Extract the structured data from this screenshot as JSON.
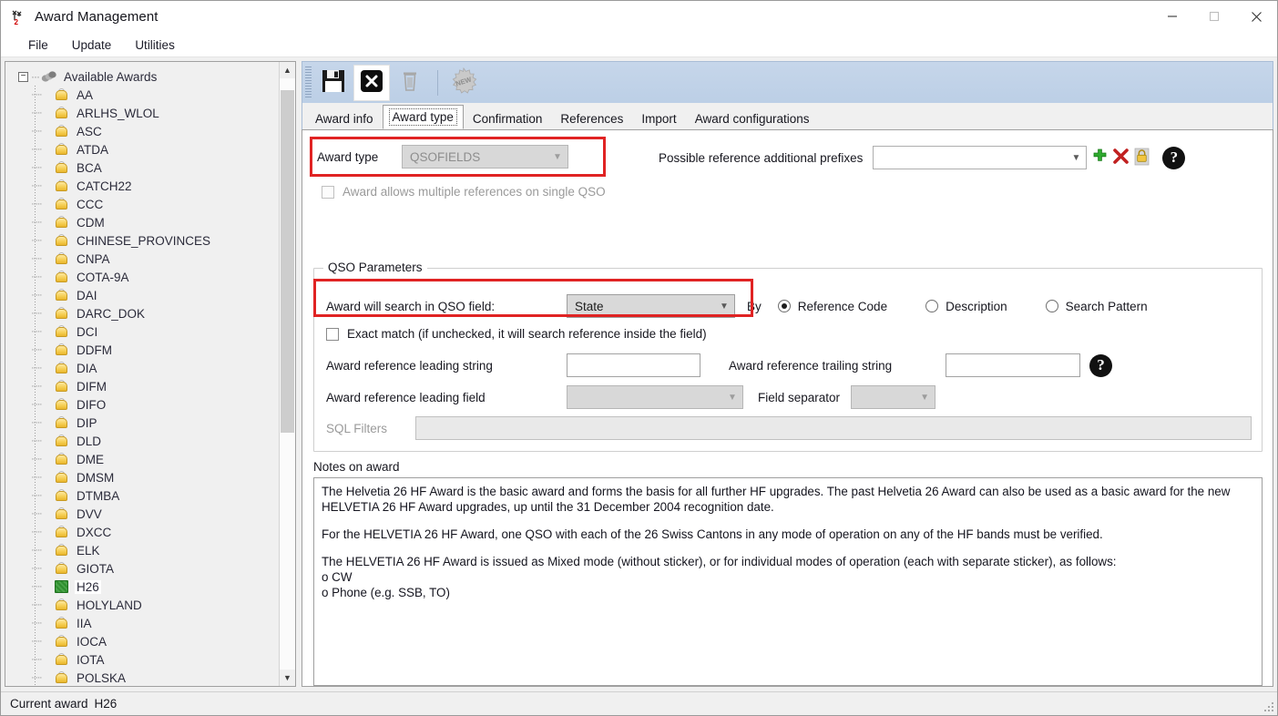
{
  "window": {
    "title": "Award Management",
    "app_icon": "antenna-icon",
    "controls": {
      "minimize": "minimize-icon",
      "maximize": "maximize-icon",
      "close": "close-icon"
    }
  },
  "menubar": {
    "items": [
      "File",
      "Update",
      "Utilities"
    ]
  },
  "sidebar": {
    "root_label": "Available Awards",
    "root_icon": "awards-stack-icon",
    "items": [
      {
        "label": "AA",
        "icon": "award-bell-icon",
        "selected": false
      },
      {
        "label": "ARLHS_WLOL",
        "icon": "award-bell-icon",
        "selected": false
      },
      {
        "label": "ASC",
        "icon": "award-bell-icon",
        "selected": false
      },
      {
        "label": "ATDA",
        "icon": "award-bell-icon",
        "selected": false
      },
      {
        "label": "BCA",
        "icon": "award-bell-icon",
        "selected": false
      },
      {
        "label": "CATCH22",
        "icon": "award-bell-icon",
        "selected": false
      },
      {
        "label": "CCC",
        "icon": "award-bell-icon",
        "selected": false
      },
      {
        "label": "CDM",
        "icon": "award-bell-icon",
        "selected": false
      },
      {
        "label": "CHINESE_PROVINCES",
        "icon": "award-bell-icon",
        "selected": false
      },
      {
        "label": "CNPA",
        "icon": "award-bell-icon",
        "selected": false
      },
      {
        "label": "COTA-9A",
        "icon": "award-bell-icon",
        "selected": false
      },
      {
        "label": "DAI",
        "icon": "award-bell-icon",
        "selected": false
      },
      {
        "label": "DARC_DOK",
        "icon": "award-bell-icon",
        "selected": false
      },
      {
        "label": "DCI",
        "icon": "award-bell-icon",
        "selected": false
      },
      {
        "label": "DDFM",
        "icon": "award-bell-icon",
        "selected": false
      },
      {
        "label": "DIA",
        "icon": "award-bell-icon",
        "selected": false
      },
      {
        "label": "DIFM",
        "icon": "award-bell-icon",
        "selected": false
      },
      {
        "label": "DIFO",
        "icon": "award-bell-icon",
        "selected": false
      },
      {
        "label": "DIP",
        "icon": "award-bell-icon",
        "selected": false
      },
      {
        "label": "DLD",
        "icon": "award-bell-icon",
        "selected": false
      },
      {
        "label": "DME",
        "icon": "award-bell-icon",
        "selected": false
      },
      {
        "label": "DMSM",
        "icon": "award-bell-icon",
        "selected": false
      },
      {
        "label": "DTMBA",
        "icon": "award-bell-icon",
        "selected": false
      },
      {
        "label": "DVV",
        "icon": "award-bell-icon",
        "selected": false
      },
      {
        "label": "DXCC",
        "icon": "award-bell-icon",
        "selected": false
      },
      {
        "label": "ELK",
        "icon": "award-bell-icon",
        "selected": false
      },
      {
        "label": "GIOTA",
        "icon": "award-bell-icon",
        "selected": false
      },
      {
        "label": "H26",
        "icon": "award-selected-icon",
        "selected": true
      },
      {
        "label": "HOLYLAND",
        "icon": "award-bell-icon",
        "selected": false
      },
      {
        "label": "IIA",
        "icon": "award-bell-icon",
        "selected": false
      },
      {
        "label": "IOCA",
        "icon": "award-bell-icon",
        "selected": false
      },
      {
        "label": "IOTA",
        "icon": "award-bell-icon",
        "selected": false
      },
      {
        "label": "POLSKA",
        "icon": "award-bell-icon",
        "selected": false
      }
    ]
  },
  "toolbar": {
    "buttons": [
      {
        "name": "save-button",
        "icon": "floppy-disk-icon",
        "enabled": true,
        "hot": false
      },
      {
        "name": "cancel-button",
        "icon": "black-x-icon",
        "enabled": true,
        "hot": true
      },
      {
        "name": "delete-button",
        "icon": "trash-icon",
        "enabled": false,
        "hot": false
      },
      {
        "name": "new-button",
        "icon": "new-starburst-icon",
        "enabled": false,
        "hot": false
      }
    ]
  },
  "tabs": [
    {
      "label": "Award info",
      "active": false
    },
    {
      "label": "Award type",
      "active": true
    },
    {
      "label": "Confirmation",
      "active": false
    },
    {
      "label": "References",
      "active": false
    },
    {
      "label": "Import",
      "active": false
    },
    {
      "label": "Award configurations",
      "active": false
    }
  ],
  "award_type_panel": {
    "award_type_label": "Award type",
    "award_type_value": "QSOFIELDS",
    "award_type_enabled": false,
    "prefixes_label": "Possible reference additional prefixes",
    "prefixes_value": "",
    "prefixes_add_icon": "green-plus-icon",
    "prefixes_delete_icon": "red-x-icon",
    "prefixes_lock_icon": "yellow-lock-icon",
    "help_icon": "question-mark-icon",
    "multiple_refs_label": "Award allows multiple references on single QSO",
    "multiple_refs_checked": false,
    "multiple_refs_enabled": false
  },
  "qso_parameters": {
    "group_title": "QSO Parameters",
    "search_field_label": "Award will search in QSO field:",
    "search_field_value": "State",
    "by_label": "By",
    "by_options": [
      {
        "label": "Reference Code",
        "selected": true
      },
      {
        "label": "Description",
        "selected": false
      },
      {
        "label": "Search Pattern",
        "selected": false
      }
    ],
    "exact_match_label": "Exact match (if unchecked, it will search reference inside the field)",
    "exact_match_checked": false,
    "leading_string_label": "Award reference leading string",
    "leading_string_value": "",
    "trailing_string_label": "Award reference trailing string",
    "trailing_string_value": "",
    "leading_field_label": "Award reference leading field",
    "leading_field_value": "",
    "field_separator_label": "Field separator",
    "field_separator_value": "",
    "sql_filters_label": "SQL Filters",
    "sql_filters_value": "",
    "help_icon": "question-mark-icon"
  },
  "notes": {
    "label": "Notes on award",
    "paragraphs": [
      "The Helvetia 26 HF Award is the basic award and forms the basis for all further HF upgrades. The past Helvetia 26 Award can also be used as a basic award for the new HELVETIA 26 HF Award upgrades, up until the 31 December 2004 recognition date.",
      "For the HELVETIA 26 HF Award, one QSO with each of the 26 Swiss Cantons in any mode of operation on any of the HF bands must be verified.",
      "The HELVETIA 26 HF Award is issued as Mixed mode (without sticker), or for individual modes of operation (each with separate sticker), as follows:\no CW\no Phone (e.g. SSB, TO)"
    ]
  },
  "statusbar": {
    "label": "Current award",
    "value": "H26",
    "grip_icon": "resize-grip-icon"
  },
  "colors": {
    "annotation": "#e02323",
    "toolbar_bg": "#c6d6ea",
    "selected_award": "#2f8f2f"
  }
}
